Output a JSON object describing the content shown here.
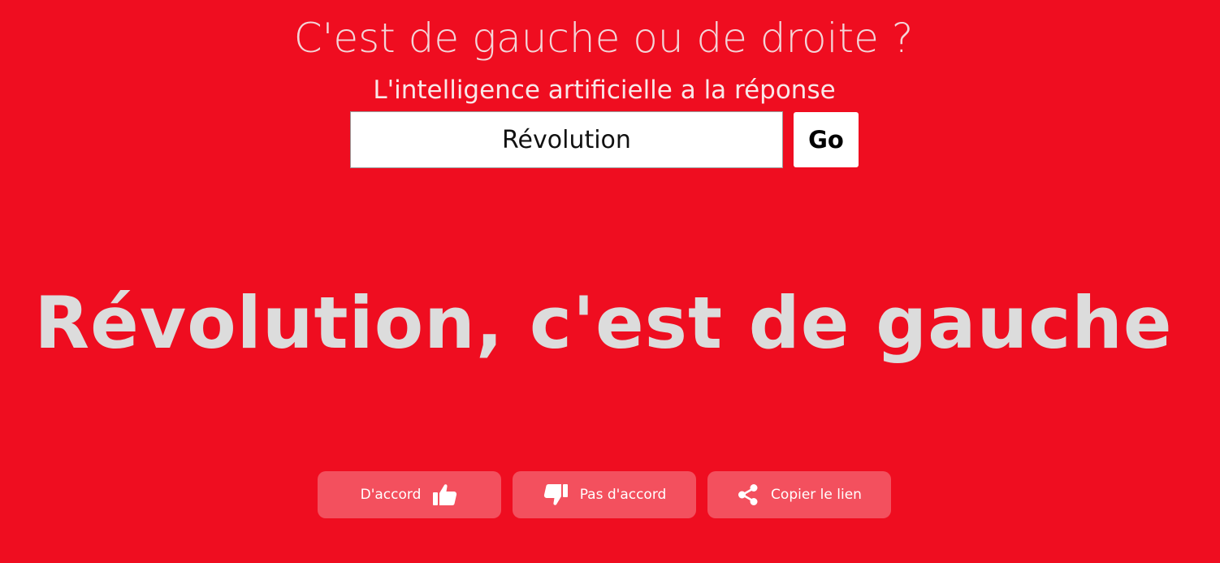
{
  "header": {
    "title": "C'est de gauche ou de droite ?",
    "subtitle": "L'intelligence artificielle a la réponse"
  },
  "search": {
    "value": "Révolution",
    "go_label": "Go"
  },
  "result": {
    "verdict": "Révolution, c'est de gauche"
  },
  "actions": {
    "agree_label": "D'accord",
    "agree_icon": "thumbs-up-icon",
    "disagree_label": "Pas d'accord",
    "disagree_icon": "thumbs-down-icon",
    "copy_label": "Copier le lien",
    "copy_icon": "share-icon"
  },
  "colors": {
    "background": "#ef0d20",
    "verdict_text": "#dcdcdc",
    "button_fill": "rgba(255,255,255,0.28)"
  }
}
